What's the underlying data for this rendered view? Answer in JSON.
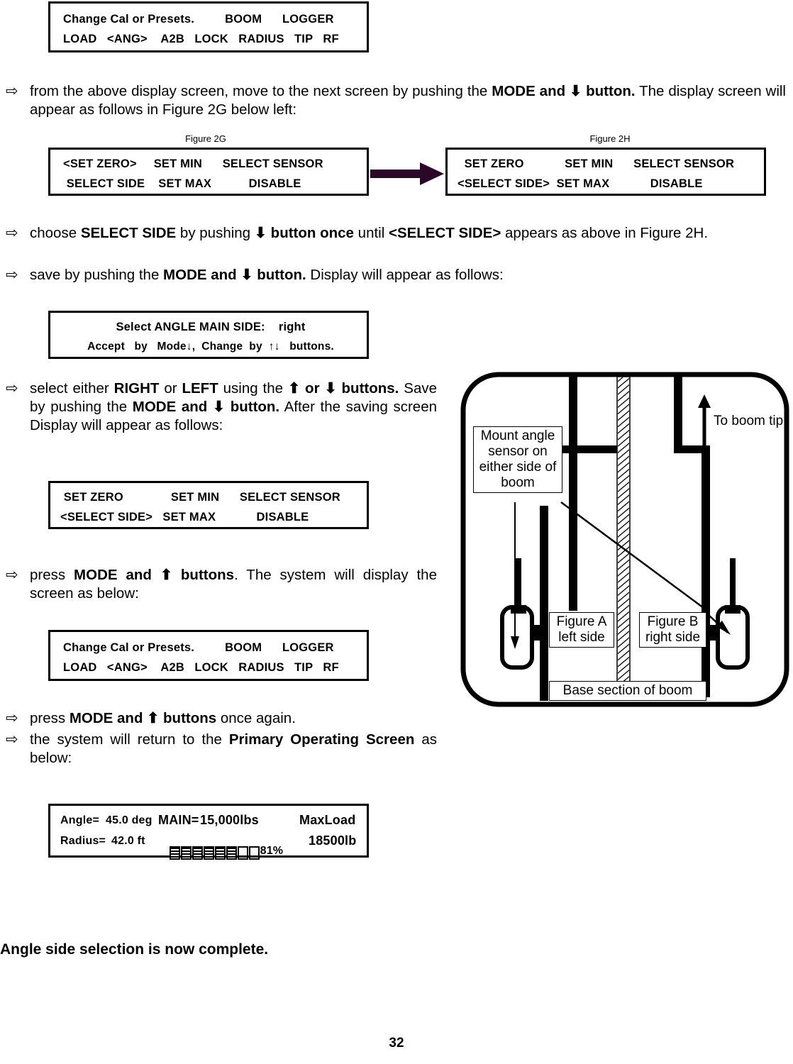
{
  "page": {
    "number": "32",
    "closing_statement": "Angle side selection is now complete."
  },
  "screens": {
    "change_cal_top": {
      "line1": "Change Cal or Presets.         BOOM      LOGGER",
      "line2": "LOAD   <ANG>    A2B   LOCK   RADIUS   TIP   RF"
    },
    "figure_2g": {
      "caption": "Figure 2G",
      "line1": "<SET ZERO>     SET MIN      SELECT SENSOR",
      "line2": " SELECT SIDE    SET MAX           DISABLE"
    },
    "figure_2h": {
      "caption": "Figure 2H",
      "line1": "  SET ZERO            SET MIN      SELECT SENSOR",
      "line2": "<SELECT SIDE>  SET MAX            DISABLE"
    },
    "select_side_prompt": {
      "line1": "Select ANGLE MAIN SIDE:    right",
      "line2": "Accept   by   Mode↓,  Change  by  ↑↓   buttons."
    },
    "menu_after_save": {
      "line1": " SET ZERO              SET MIN      SELECT SENSOR",
      "line2": "<SELECT SIDE>   SET MAX            DISABLE"
    },
    "change_cal_bottom": {
      "line1": "Change Cal or Presets.         BOOM      LOGGER",
      "line2": "LOAD   <ANG>    A2B   LOCK   RADIUS   TIP   RF"
    },
    "primary_operating": {
      "angle_label": "Angle=",
      "angle_value": "45.0 deg",
      "main_label": "MAIN=",
      "main_value": "15,000lbs",
      "maxload_label": "MaxLoad",
      "radius_label": "Radius=",
      "radius_value": "42.0 ft",
      "percent": "81%",
      "maxload_value": "18500lb",
      "bar_segments_total": 8,
      "bar_segments_filled": 6
    }
  },
  "instructions": {
    "step1": {
      "text_a": "from the above display screen, move to the next screen by pushing the ",
      "bold_b": "MODE  and  ⬇  button.",
      "text_c": " The display screen will appear as follows in Figure 2G below left:"
    },
    "step2": {
      "text_a": "choose ",
      "bold_b": "SELECT SIDE",
      "text_c": "  by pushing ",
      "bold_d": "⬇ button once",
      "text_e": " until  ",
      "bold_f": "<SELECT SIDE>",
      "text_g": "  appears as above in Figure 2H."
    },
    "step3": {
      "text_a": "save by pushing the ",
      "bold_b": "MODE and ⬇ button.",
      "text_c": "   Display will appear as follows:"
    },
    "step4": {
      "text_a": "select either ",
      "bold_b": "RIGHT",
      "text_c": " or ",
      "bold_d": "LEFT",
      "text_e": " using the ",
      "bold_f": "⬆ or ⬇ buttons.",
      "text_g": " Save by pushing the ",
      "bold_h": "MODE and ⬇ button.",
      "text_i": "   After the saving screen Display will appear as follows:"
    },
    "step5": {
      "text_a": "press ",
      "bold_b": "MODE and ⬆ buttons",
      "text_c": ".   The system will display the screen as below:"
    },
    "step6": {
      "text_a": "press ",
      "bold_b": "MODE and ⬆ buttons",
      "text_c": " once again."
    },
    "step7": {
      "text_a": "the   system will return to the ",
      "bold_b": "Primary Operating Screen",
      "text_c": " as below:"
    }
  },
  "diagram": {
    "mount_note": "Mount angle\nsensor on\neither side of\nboom",
    "to_boom_tip": "To boom tip",
    "figure_a": "Figure A\nleft side",
    "figure_b": "Figure B\nright side",
    "base_section": "Base section of boom"
  },
  "colors": {
    "flow_arrow": "#2b0728",
    "ink": "#000000",
    "paper": "#ffffff"
  },
  "icons": {
    "bullet": "⇨",
    "arrow_down": "⬇",
    "arrow_up": "⬆",
    "flow_arrow": "right-arrow-icon"
  }
}
